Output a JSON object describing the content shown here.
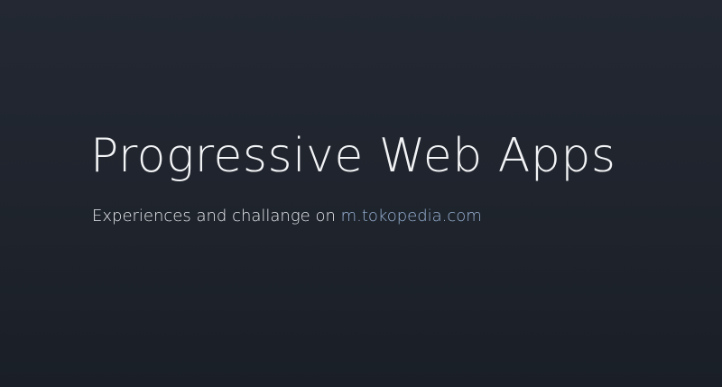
{
  "slide": {
    "title": "Progressive Web Apps",
    "subtitle_prefix": "Experiences and challange on ",
    "subtitle_link": "m.tokopedia.com"
  },
  "colors": {
    "background_top": "#232833",
    "background_bottom": "#1a1f27",
    "title": "#f2f3f5",
    "subtitle": "#e6e8ec",
    "link": "#9ab4d6"
  }
}
